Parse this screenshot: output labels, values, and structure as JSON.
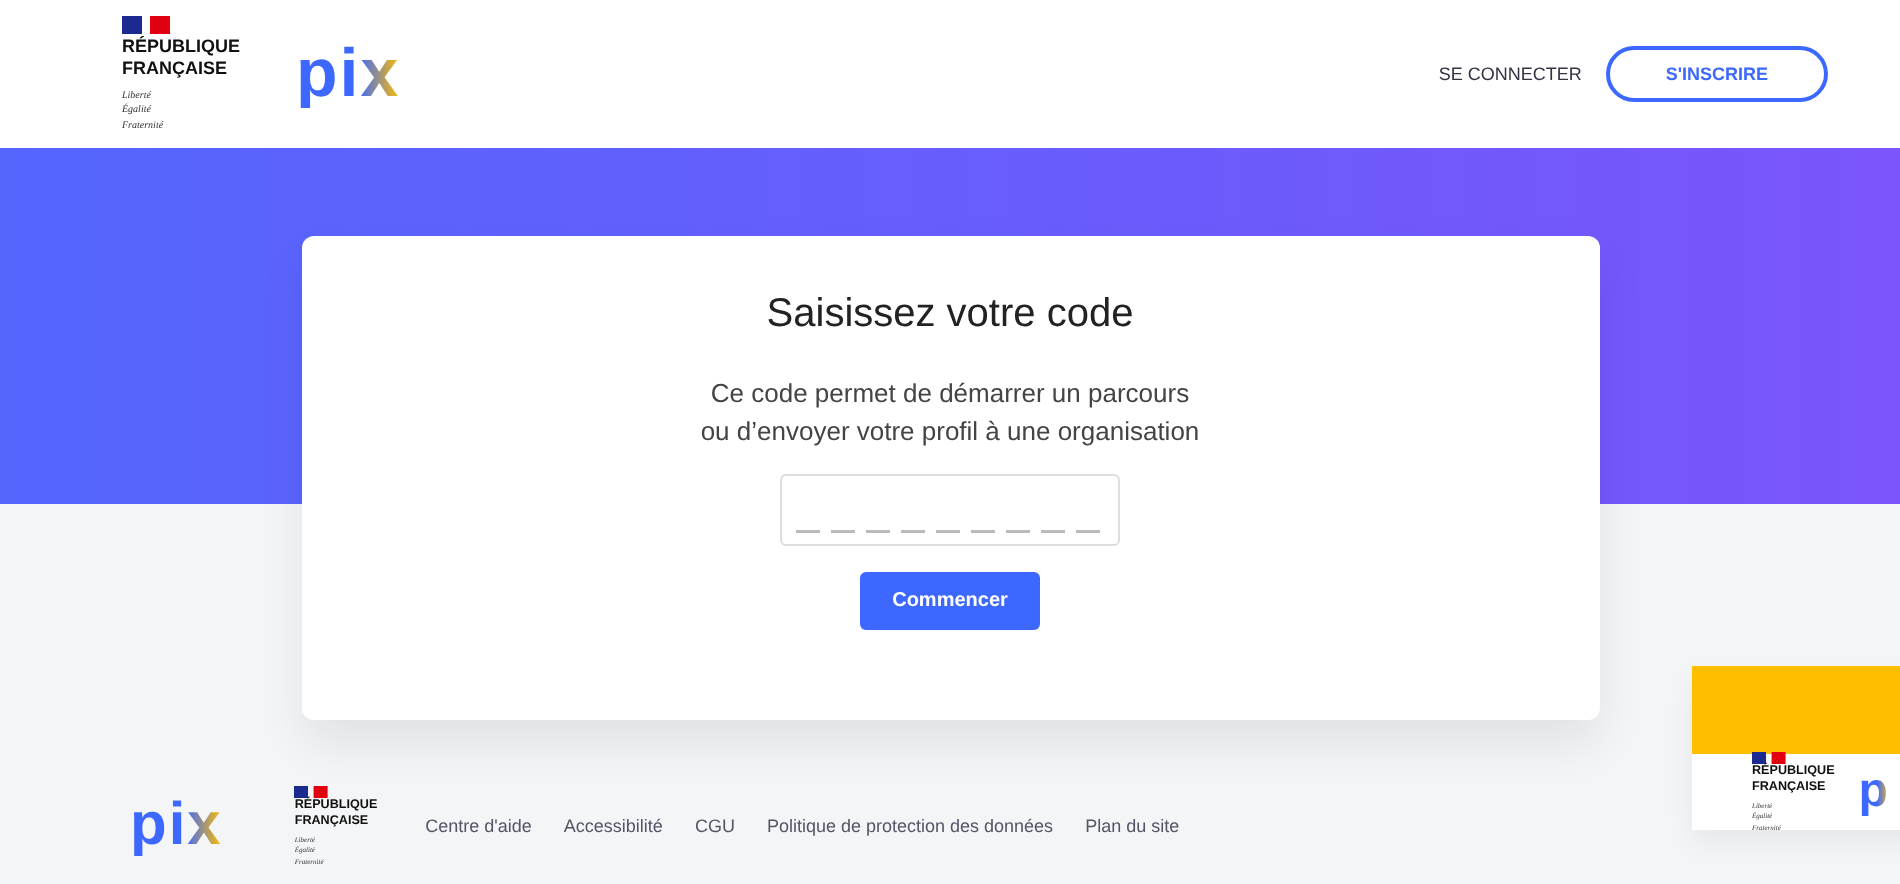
{
  "header": {
    "republic_logo": {
      "lines": [
        "RÉPUBLIQUE",
        "FRANÇAISE"
      ],
      "motto": [
        "Liberté",
        "Égalité",
        "Fraternité"
      ]
    },
    "pix_logo": "pix",
    "links": [
      {
        "label": "SE CONNECTER",
        "kind": "link"
      },
      {
        "label": "S'INSCRIRE",
        "kind": "outlined"
      }
    ]
  },
  "card": {
    "title": "Saisissez votre code",
    "description": [
      "Ce code permet de démarrer un parcours",
      "ou d’envoyer votre profil à une organisation"
    ],
    "button": "Commencer"
  },
  "footer": {
    "pix_logo": "pix",
    "republic_logo": {
      "lines": [
        "RÉPUBLIQUE",
        "FRANÇAISE"
      ],
      "motto": [
        "Liberté",
        "Égalité",
        "Fraternité"
      ]
    },
    "links": [
      "Centre d'aide",
      "Accessibilité",
      "CGU",
      "Politique de protection des données",
      "Plan du site"
    ]
  },
  "side_card": {
    "republic_logo": {
      "lines": [
        "RÉPUBLIQUE",
        "FRANÇAISE"
      ],
      "motto": [
        "Liberté",
        "Égalité",
        "Fraternité"
      ]
    },
    "pix_logo": "p"
  }
}
